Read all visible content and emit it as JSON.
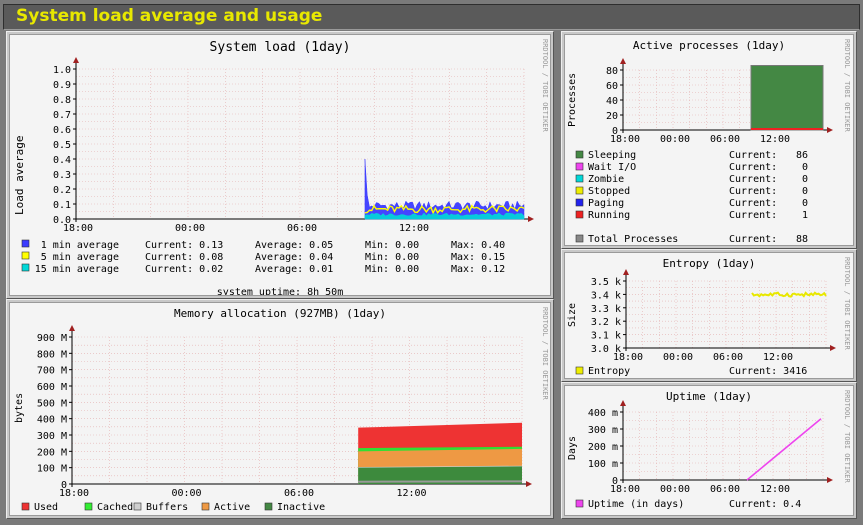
{
  "page_title": "System load average and usage",
  "side_credit": "RRDTOOL / TOBI OETIKER",
  "time_labels": [
    "18:00",
    "00:00",
    "06:00",
    "12:00"
  ],
  "colors": {
    "title": "#e8e800",
    "frame": "#5a5a5a",
    "panel": "#c8c8c8",
    "graph_bg": "#f4f4f4"
  },
  "panels": {
    "load": {
      "title": "System load   (1day)",
      "ylabel": "Load average",
      "yticks": [
        "1.0",
        "0.9",
        "0.8",
        "0.7",
        "0.6",
        "0.5",
        "0.4",
        "0.3",
        "0.2",
        "0.1",
        "0.0"
      ],
      "legend": [
        {
          "label": "1 min average",
          "current": "Current: 0.13",
          "average": "Average: 0.05",
          "min": "Min: 0.00",
          "max": "Max: 0.40",
          "color": "#3b3bff"
        },
        {
          "label": "5 min average",
          "current": "Current: 0.08",
          "average": "Average: 0.04",
          "min": "Min: 0.00",
          "max": "Max: 0.15",
          "color": "#ffff00"
        },
        {
          "label": "15 min average",
          "current": "Current: 0.02",
          "average": "Average: 0.01",
          "min": "Min: 0.00",
          "max": "Max: 0.12",
          "color": "#00d8d8"
        }
      ],
      "uptime": "system uptime:  8h 50m"
    },
    "memory": {
      "title": "Memory allocation (927MB)  (1day)",
      "ylabel": "bytes",
      "yticks": [
        "900 M",
        "800 M",
        "700 M",
        "600 M",
        "500 M",
        "400 M",
        "300 M",
        "200 M",
        "100 M",
        "0"
      ],
      "legend": [
        {
          "label": "Used",
          "color": "#ee3333"
        },
        {
          "label": "Cached",
          "color": "#33ee33"
        },
        {
          "label": "Buffers",
          "color": "#d0d0d0"
        },
        {
          "label": "Active",
          "color": "#ee9944"
        },
        {
          "label": "Inactive",
          "color": "#448844"
        }
      ]
    },
    "processes": {
      "title": "Active processes  (1day)",
      "ylabel": "Processes",
      "yticks": [
        "80",
        "60",
        "40",
        "20",
        "0"
      ],
      "legend": [
        {
          "label": "Sleeping",
          "current": "Current:",
          "value": "86",
          "color": "#448844"
        },
        {
          "label": "Wait I/O",
          "current": "Current:",
          "value": "0",
          "color": "#ee44ee"
        },
        {
          "label": "Zombie",
          "current": "Current:",
          "value": "0",
          "color": "#00d8d8"
        },
        {
          "label": "Stopped",
          "current": "Current:",
          "value": "0",
          "color": "#eeee00"
        },
        {
          "label": "Paging",
          "current": "Current:",
          "value": "0",
          "color": "#2222ee"
        },
        {
          "label": "Running",
          "current": "Current:",
          "value": "1",
          "color": "#ee2222"
        }
      ],
      "total": {
        "label": "Total Processes",
        "current": "Current:",
        "value": "88",
        "color": "#888888"
      }
    },
    "entropy": {
      "title": "Entropy  (1day)",
      "ylabel": "Size",
      "yticks": [
        "3.5 k",
        "3.4 k",
        "3.3 k",
        "3.2 k",
        "3.1 k",
        "3.0 k"
      ],
      "legend": {
        "label": "Entropy",
        "current": "Current: 3416",
        "color": "#eeee00"
      }
    },
    "uptime": {
      "title": "Uptime  (1day)",
      "ylabel": "Days",
      "yticks": [
        "400 m",
        "300 m",
        "200 m",
        "100 m",
        "0"
      ],
      "legend": {
        "label": "Uptime   (in days)",
        "current": "Current:  0.4",
        "color": "#ee44ee"
      }
    }
  },
  "chart_data": [
    {
      "type": "area",
      "title": "System load   (1day)",
      "ylabel": "Load average",
      "ylim": [
        0,
        1.0
      ],
      "x": [
        "18:00",
        "00:00",
        "06:00",
        "12:00"
      ],
      "series": [
        {
          "name": "1 min average",
          "current": 0.13,
          "average": 0.05,
          "min": 0.0,
          "max": 0.4
        },
        {
          "name": "5 min average",
          "current": 0.08,
          "average": 0.04,
          "min": 0.0,
          "max": 0.15
        },
        {
          "name": "15 min average",
          "current": 0.02,
          "average": 0.01,
          "min": 0.0,
          "max": 0.12
        }
      ]
    },
    {
      "type": "area",
      "title": "Memory allocation (927MB)  (1day)",
      "ylabel": "bytes",
      "ylim": [
        0,
        927
      ],
      "x": [
        "18:00",
        "00:00",
        "06:00",
        "12:00"
      ],
      "series": [
        {
          "name": "Inactive",
          "approx_M": [
            100,
            110
          ]
        },
        {
          "name": "Active",
          "approx_M": [
            110,
            130
          ]
        },
        {
          "name": "Buffers",
          "approx_M": [
            5,
            5
          ]
        },
        {
          "name": "Cached",
          "approx_M": [
            10,
            12
          ]
        },
        {
          "name": "Used",
          "approx_M": [
            110,
            130
          ]
        }
      ]
    },
    {
      "type": "area",
      "title": "Active processes  (1day)",
      "ylabel": "Processes",
      "ylim": [
        0,
        80
      ],
      "series": [
        {
          "name": "Sleeping",
          "current": 86
        },
        {
          "name": "Wait I/O",
          "current": 0
        },
        {
          "name": "Zombie",
          "current": 0
        },
        {
          "name": "Stopped",
          "current": 0
        },
        {
          "name": "Paging",
          "current": 0
        },
        {
          "name": "Running",
          "current": 1
        },
        {
          "name": "Total Processes",
          "current": 88
        }
      ]
    },
    {
      "type": "line",
      "title": "Entropy  (1day)",
      "ylabel": "Size",
      "ylim": [
        3.0,
        3.5
      ],
      "series": [
        {
          "name": "Entropy",
          "current": 3416
        }
      ]
    },
    {
      "type": "line",
      "title": "Uptime  (1day)",
      "ylabel": "Days",
      "ylim": [
        0,
        0.4
      ],
      "series": [
        {
          "name": "Uptime   (in days)",
          "current": 0.4
        }
      ]
    }
  ]
}
